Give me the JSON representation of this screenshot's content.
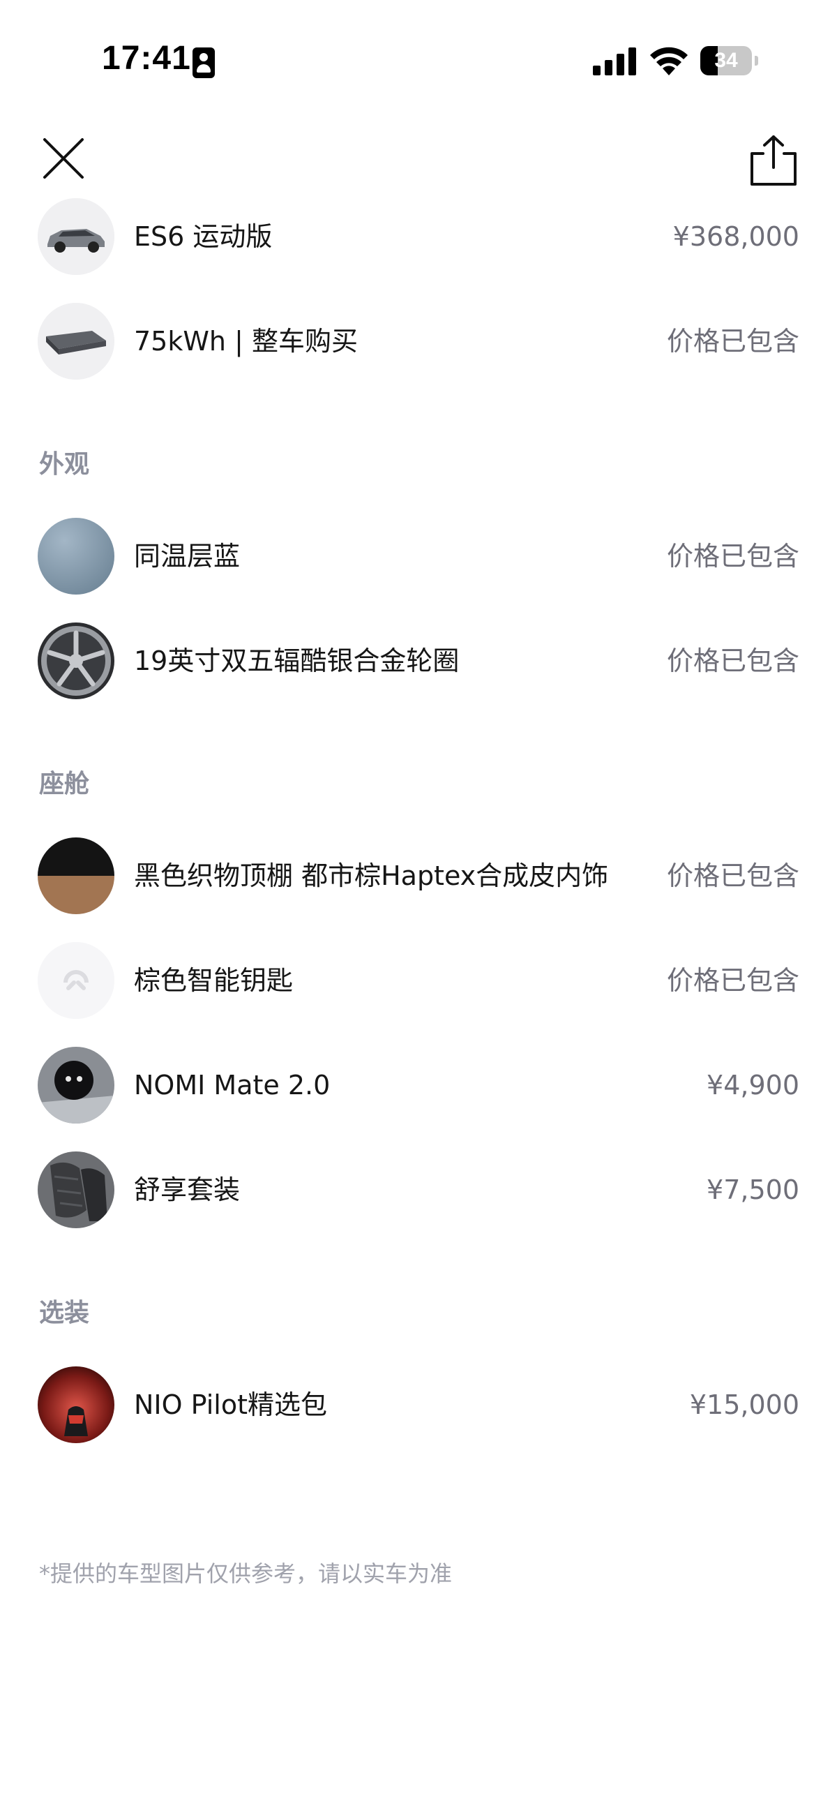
{
  "status_bar": {
    "time": "17:41",
    "battery": "34",
    "battery_level": 0.34
  },
  "header": {
    "close_icon": "close-icon",
    "share_icon": "share-icon"
  },
  "vehicle": {
    "items": [
      {
        "label": "ES6 运动版",
        "price": "¥368,000"
      },
      {
        "label": "75kWh | 整车购买",
        "price": "价格已包含"
      }
    ]
  },
  "exterior": {
    "title": "外观",
    "items": [
      {
        "label": "同温层蓝",
        "price": "价格已包含"
      },
      {
        "label": "19英寸双五辐酷银合金轮圈",
        "price": "价格已包含"
      }
    ]
  },
  "cabin": {
    "title": "座舱",
    "items": [
      {
        "label": "黑色织物顶棚 都市棕Haptex合成皮内饰",
        "price": "价格已包含"
      },
      {
        "label": "棕色智能钥匙",
        "price": "价格已包含"
      },
      {
        "label": "NOMI Mate 2.0",
        "price": "¥4,900"
      },
      {
        "label": "舒享套装",
        "price": "¥7,500"
      }
    ]
  },
  "options": {
    "title": "选装",
    "items": [
      {
        "label": "NIO Pilot精选包",
        "price": "¥15,000"
      }
    ]
  },
  "disclaimer": "*提供的车型图片仅供参考，请以实车为准",
  "colors": {
    "price_text": "#6e6e78",
    "section_title": "#8c8f9c",
    "paint_swatch": "#7f96a8"
  }
}
